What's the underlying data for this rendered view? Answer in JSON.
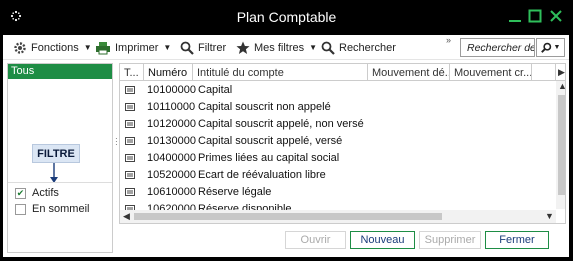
{
  "window": {
    "title": "Plan Comptable",
    "controls": [
      "minimize-icon",
      "maximize-icon",
      "close-icon"
    ]
  },
  "toolbar": {
    "fonctions": "Fonctions",
    "imprimer": "Imprimer",
    "filtrer": "Filtrer",
    "mes_filtres": "Mes filtres",
    "rechercher": "Rechercher",
    "more": "»",
    "search_placeholder": "Rechercher des m"
  },
  "left_panel": {
    "tous": "Tous",
    "filtre_label": "FILTRE",
    "actifs": {
      "label": "Actifs",
      "checked": true
    },
    "en_sommeil": {
      "label": "En sommeil",
      "checked": false
    }
  },
  "grid": {
    "columns": [
      "T...",
      "Numéro",
      "Intitulé du compte",
      "Mouvement dé...",
      "Mouvement cr..."
    ],
    "rows": [
      {
        "numero": "10100000",
        "intitule": "Capital"
      },
      {
        "numero": "10110000",
        "intitule": "Capital souscrit non appelé"
      },
      {
        "numero": "10120000",
        "intitule": "Capital souscrit appelé, non versé"
      },
      {
        "numero": "10130000",
        "intitule": "Capital souscrit appelé, versé"
      },
      {
        "numero": "10400000",
        "intitule": "Primes liées au capital social"
      },
      {
        "numero": "10520000",
        "intitule": "Ecart de réévaluation libre"
      },
      {
        "numero": "10610000",
        "intitule": "Réserve légale"
      },
      {
        "numero": "10620000",
        "intitule": "Réserve disponible"
      }
    ]
  },
  "buttons": {
    "ouvrir": "Ouvrir",
    "nouveau": "Nouveau",
    "supprimer": "Supprimer",
    "fermer": "Fermer"
  },
  "colors": {
    "accent_green": "#1e8d45",
    "title_bar": "#000000"
  }
}
